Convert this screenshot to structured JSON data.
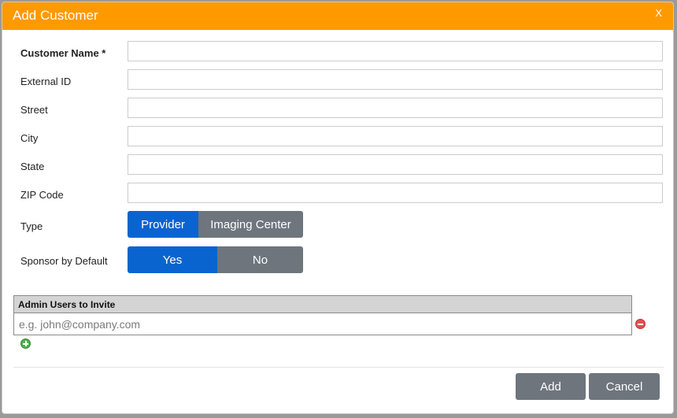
{
  "modal": {
    "title": "Add Customer",
    "close_label": "X"
  },
  "fields": [
    {
      "label": "Customer Name *",
      "value": "",
      "placeholder": ""
    },
    {
      "label": "External ID",
      "value": "",
      "placeholder": ""
    },
    {
      "label": "Street",
      "value": "",
      "placeholder": ""
    },
    {
      "label": "City",
      "value": "",
      "placeholder": ""
    },
    {
      "label": "State",
      "value": "",
      "placeholder": ""
    },
    {
      "label": "ZIP Code",
      "value": "",
      "placeholder": ""
    }
  ],
  "type_toggle": {
    "label": "Type",
    "options": [
      "Provider",
      "Imaging Center"
    ],
    "selected": "Provider"
  },
  "sponsor_toggle": {
    "label": "Sponsor by Default",
    "options": [
      "Yes",
      "No"
    ],
    "selected": "Yes"
  },
  "invite": {
    "header": "Admin Users to Invite",
    "placeholder": "e.g. john@company.com",
    "value": ""
  },
  "actions": {
    "add_label": "Add",
    "cancel_label": "Cancel"
  },
  "colors": {
    "header": "#ff9900",
    "active_toggle": "#0a64d0",
    "inactive_toggle": "#6e757d",
    "button": "#6e757d"
  },
  "icons": {
    "remove": "remove-circle-icon",
    "add": "add-circle-icon"
  }
}
